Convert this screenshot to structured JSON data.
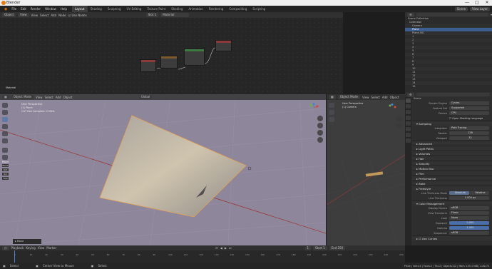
{
  "window": {
    "title": "Blender",
    "controls": [
      "—",
      "□",
      "✕"
    ]
  },
  "menu": {
    "items": [
      "File",
      "Edit",
      "Render",
      "Window",
      "Help"
    ]
  },
  "workspaces": {
    "tabs": [
      "Layout",
      "Shading",
      "Sculpting",
      "UV Editing",
      "Texture Paint",
      "Shading",
      "Animation",
      "Rendering",
      "Compositing",
      "Scripting"
    ],
    "active": 0
  },
  "scene": {
    "name": "Scene",
    "view_layer": "View Layer"
  },
  "node_editor": {
    "header": {
      "editor": "Object",
      "mode": "View",
      "menus": [
        "View",
        "Select",
        "Add",
        "Node"
      ],
      "use_nodes": "Use Nodes",
      "slot": "Slot 1",
      "material": "Material"
    },
    "label": "Material"
  },
  "viewport": {
    "header": {
      "mode": "Object Mode",
      "menus": [
        "View",
        "Select",
        "Add",
        "Object"
      ],
      "orientation": "Global"
    },
    "overlay_lines": [
      "User Perspective",
      "(1) Plane",
      "CUT Rail Complete 13 BCA"
    ],
    "tool_section": "Move",
    "footer_label": "Move",
    "tool_labels": [
      "Move",
      "Rot",
      "Scl",
      "Trns"
    ]
  },
  "right_view": {
    "header": {
      "mode": "Object Mode",
      "menus": [
        "View",
        "Select",
        "Add",
        "Object"
      ]
    },
    "overlay_lines": [
      "User Perspective",
      "(1) Camera"
    ]
  },
  "outliner": {
    "title": "Scene Collection",
    "items": [
      {
        "label": "Collection",
        "selected": false
      },
      {
        "label": "Camera",
        "selected": false
      },
      {
        "label": "Plane",
        "selected": true
      },
      {
        "label": "Plane.001",
        "selected": false
      },
      {
        "label": "1",
        "selected": false
      },
      {
        "label": "2",
        "selected": false
      },
      {
        "label": "3",
        "selected": false
      },
      {
        "label": "4",
        "selected": false
      },
      {
        "label": "5",
        "selected": false
      },
      {
        "label": "6",
        "selected": false
      },
      {
        "label": "7",
        "selected": false
      },
      {
        "label": "8",
        "selected": false
      },
      {
        "label": "9",
        "selected": false
      },
      {
        "label": "10",
        "selected": false
      },
      {
        "label": "11",
        "selected": false
      },
      {
        "label": "12",
        "selected": false
      },
      {
        "label": "13",
        "selected": false
      },
      {
        "label": "14",
        "selected": false
      },
      {
        "label": "15",
        "selected": false
      }
    ]
  },
  "properties": {
    "scene_name": "Scene",
    "render_engine": {
      "label": "Render Engine",
      "value": "Cycles"
    },
    "feature_set": {
      "label": "Feature Set",
      "value": "Supported"
    },
    "device": {
      "label": "Device",
      "value": "CPU"
    },
    "osl": "Open Shading Language",
    "sampling": {
      "title": "Sampling",
      "integrator_label": "Integrator",
      "integrator": "Path Tracing",
      "render_label": "Render",
      "render": "128",
      "viewport_label": "Viewport",
      "viewport": "32"
    },
    "sections": [
      "Advanced",
      "Light Paths",
      "Volumes",
      "Hair",
      "Simplify",
      "Motion Blur",
      "Film",
      "Performance",
      "Bake",
      "Freestyle"
    ],
    "freestyle": {
      "line_thickness_mode": "Line Thickness Mode",
      "absolute": "Absolute",
      "relative": "Relative",
      "line_thickness_label": "Line Thickness",
      "line_thickness": "1.000 px"
    },
    "color_management": {
      "title": "Color Management",
      "display_device_label": "Display Device",
      "display_device": "sRGB",
      "view_transform_label": "View Transform",
      "view_transform": "Filmic",
      "look_label": "Look",
      "look": "None",
      "exposure_label": "Exposure",
      "exposure": "0.000",
      "gamma_label": "Gamma",
      "gamma": "1.000",
      "sequencer_label": "Sequencer",
      "sequencer": "sRGB",
      "use_curves": "Use Curves"
    }
  },
  "timeline": {
    "menus": [
      "Playback",
      "Keying",
      "View",
      "Marker"
    ],
    "current_frame": "1",
    "start_label": "Start",
    "start": "1",
    "end_label": "End",
    "end": "250",
    "ticks": [
      "0",
      "10",
      "20",
      "30",
      "40",
      "50",
      "60",
      "70",
      "80",
      "90",
      "100",
      "110",
      "120",
      "130",
      "140",
      "150",
      "160",
      "170",
      "180",
      "190",
      "200",
      "210",
      "220",
      "230",
      "240",
      "250"
    ]
  },
  "status": {
    "left": "Select",
    "middle": "Center View to Mouse",
    "right_tool": "Select",
    "stats": "Plane | Verts:4 | Faces:1 | Tris:2 | Objects:1/2 | Mem: 135.1 MiB | 2.80.75"
  },
  "colors": {
    "accent": "#e87d0d",
    "selection": "#3b5d8f",
    "viewport_bg": "#8e869a",
    "x_axis": "#9b3a3a"
  }
}
